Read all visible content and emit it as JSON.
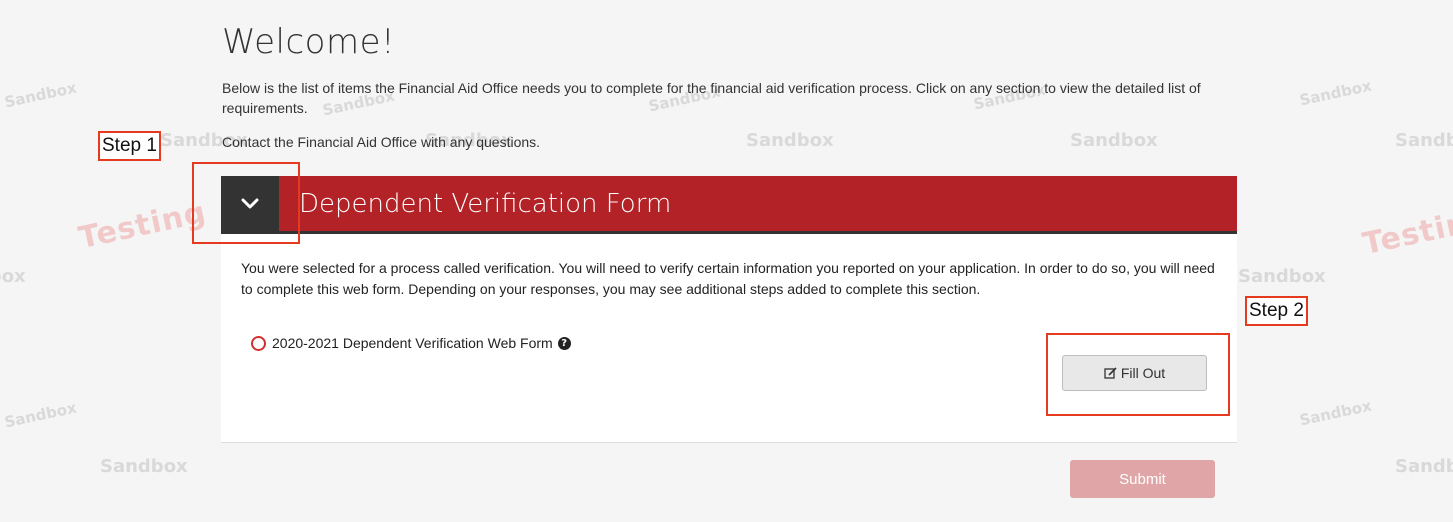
{
  "page": {
    "title": "Welcome!",
    "intro": "Below is the list of items the Financial Aid Office needs you to complete for the financial aid verification process. Click on any section to view the detailed list of requirements.",
    "contact": "Contact the Financial Aid Office with any questions."
  },
  "panel": {
    "title": "Dependent Verification Form",
    "toggle_icon": "chevron-down-icon",
    "description": "You were selected for a process called verification. You will need to verify certain information you reported on your application. In order to do so, you will need to complete this web form. Depending on your responses, you may see additional steps added to complete this section.",
    "item": {
      "status_icon": "radio-empty-icon",
      "label": "2020-2021 Dependent Verification Web Form",
      "help_icon": "question-circle-icon"
    },
    "fill_out_label": "Fill Out",
    "fill_out_icon": "edit-icon",
    "submit_label": "Submit"
  },
  "annotations": {
    "step1": "Step 1",
    "step2": "Step 2"
  },
  "watermarks": {
    "sandbox": "Sandbox",
    "testing": "Testing"
  },
  "colors": {
    "header_red": "#b32226",
    "toggle_dark": "#333333",
    "annotation_red": "#e53a1e",
    "submit_disabled": "#e0a6a7"
  }
}
